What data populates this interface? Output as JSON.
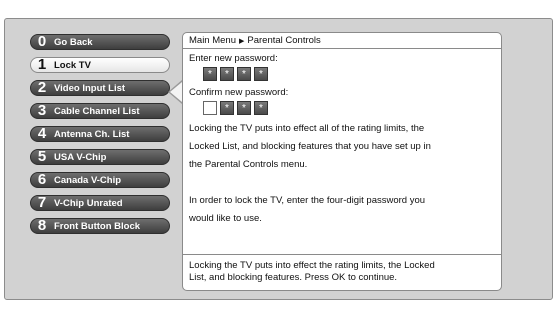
{
  "menu": {
    "items": [
      {
        "num": "0",
        "label": "Go Back"
      },
      {
        "num": "1",
        "label": "Lock TV"
      },
      {
        "num": "2",
        "label": "Video Input List"
      },
      {
        "num": "3",
        "label": "Cable Channel List"
      },
      {
        "num": "4",
        "label": "Antenna Ch. List"
      },
      {
        "num": "5",
        "label": "USA V-Chip"
      },
      {
        "num": "6",
        "label": "Canada V-Chip"
      },
      {
        "num": "7",
        "label": "V-Chip Unrated"
      },
      {
        "num": "8",
        "label": "Front Button Block"
      }
    ],
    "selected_index": 1
  },
  "panel": {
    "breadcrumb": {
      "root": "Main Menu",
      "separator": "▶",
      "current": "Parental Controls"
    },
    "enter_label": "Enter new password:",
    "enter_boxes": [
      "*",
      "*",
      "*",
      "*"
    ],
    "confirm_label": "Confirm new password:",
    "confirm_boxes": [
      "",
      "*",
      "*",
      "*"
    ],
    "paragraph1": [
      "Locking the TV puts into effect all of the rating limits, the",
      "Locked List, and blocking features that you have set up in",
      "the Parental Controls menu."
    ],
    "paragraph2": [
      "In order to lock the TV, enter the four-digit password you",
      "would like to use."
    ],
    "footer": [
      "Locking the TV puts into effect the rating limits, the Locked",
      "List, and blocking features. Press OK to continue."
    ]
  }
}
